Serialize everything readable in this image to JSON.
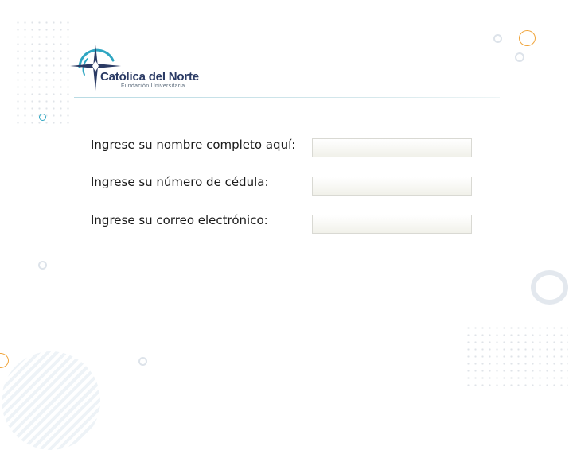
{
  "logo": {
    "title": "Católica del Norte",
    "subtitle": "Fundación Universitaria"
  },
  "form": {
    "fields": [
      {
        "label": "Ingrese su nombre completo aquí:",
        "value": "",
        "placeholder": ""
      },
      {
        "label": "Ingrese su número de cédula:",
        "value": "",
        "placeholder": ""
      },
      {
        "label": "Ingrese su correo electrónico:",
        "value": "",
        "placeholder": ""
      }
    ]
  },
  "colors": {
    "brand_navy": "#2a3a64",
    "brand_teal": "#2fa6c2",
    "accent_orange": "#f0a43a",
    "ring_gray": "#dde3ea"
  }
}
